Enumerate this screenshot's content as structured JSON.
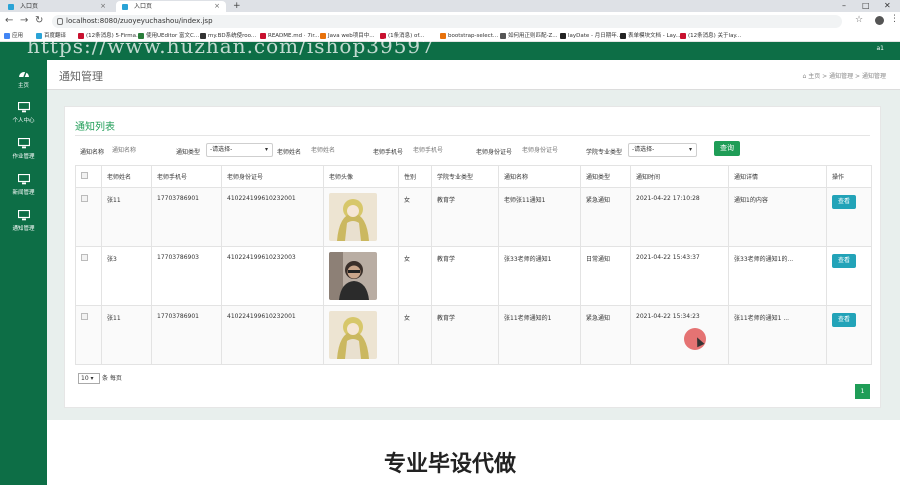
{
  "browser": {
    "tabs": [
      {
        "title": "入口页"
      },
      {
        "title": "入口页"
      }
    ],
    "url": "localhost:8080/zuoyeyuchashou/index.jsp",
    "bookmarks": [
      {
        "label": "应用",
        "color": "#4285f4"
      },
      {
        "label": "百度翻译",
        "color": "#2aa3d6"
      },
      {
        "label": "(12条消息) 5·Firma...",
        "color": "#c8102e"
      },
      {
        "label": "使用UEditor 富文C...",
        "color": "#2a7d3a"
      },
      {
        "label": "my.BD系统使roo...",
        "color": "#333333"
      },
      {
        "label": "README.md · 7ir...",
        "color": "#c8102e"
      },
      {
        "label": "Java web项目中...",
        "color": "#e8710a"
      },
      {
        "label": "(1条消息) of...",
        "color": "#c8102e"
      },
      {
        "label": "bootstrap-select...",
        "color": "#e8710a"
      },
      {
        "label": "如何用正则匹配-Z...",
        "color": "#555555"
      },
      {
        "label": "layDate - 月日期年...",
        "color": "#222222"
      },
      {
        "label": "表单模块文档 - Lay...",
        "color": "#222222"
      },
      {
        "label": "(12条消息) 关于lay...",
        "color": "#c8102e"
      }
    ]
  },
  "header": {
    "user": "a1"
  },
  "sidebar": {
    "items": [
      {
        "label": "主页",
        "icon": "dashboard-icon"
      },
      {
        "label": "个人中心",
        "icon": "monitor-icon"
      },
      {
        "label": "作业管理",
        "icon": "monitor-icon"
      },
      {
        "label": "新闻管理",
        "icon": "monitor-icon"
      },
      {
        "label": "通知管理",
        "icon": "monitor-icon"
      }
    ]
  },
  "page": {
    "title": "通知管理",
    "breadcrumb": [
      "主页",
      "通知管理",
      "通知管理"
    ]
  },
  "panel": {
    "title": "通知列表",
    "filters": {
      "notice_name_label": "通知名称",
      "notice_name_placeholder": "通知名称",
      "notice_type_label": "通知类型",
      "notice_type_value": "-请选择-",
      "teacher_name_label": "老师姓名",
      "teacher_name_placeholder": "老师姓名",
      "teacher_phone_label": "老师手机号",
      "teacher_phone_placeholder": "老师手机号",
      "teacher_id_label": "老师身份证号",
      "teacher_id_placeholder": "老师身份证号",
      "major_label": "学院专业类型",
      "major_value": "-请选择-",
      "search_button": "查询"
    },
    "table": {
      "columns": [
        "",
        "老师姓名",
        "老师手机号",
        "老师身份证号",
        "老师头像",
        "性别",
        "学院专业类型",
        "通知名称",
        "通知类型",
        "通知时间",
        "通知详情",
        "操作"
      ],
      "rows": [
        {
          "name": "张11",
          "phone": "17703786901",
          "id_card": "410224199610232001",
          "avatar": "avatar-girl",
          "gender": "女",
          "major": "教育学",
          "notice_name": "老师张11通知1",
          "notice_type": "紧急通知",
          "time": "2021-04-22 17:10:28",
          "detail": "通知1的内容",
          "action": "查看"
        },
        {
          "name": "张3",
          "phone": "17703786903",
          "id_card": "410224199610232003",
          "avatar": "avatar-man",
          "gender": "女",
          "major": "教育学",
          "notice_name": "张33老师的通知1",
          "notice_type": "日常通知",
          "time": "2021-04-22 15:43:37",
          "detail": "张33老师的通知1的...",
          "action": "查看"
        },
        {
          "name": "张11",
          "phone": "17703786901",
          "id_card": "410224199610232001",
          "avatar": "avatar-girl",
          "gender": "女",
          "major": "教育学",
          "notice_name": "张11老师通知的1",
          "notice_type": "紧急通知",
          "time": "2021-04-22 15:34:23",
          "detail": "张11老师的通知1 ...",
          "action": "查看"
        }
      ]
    },
    "pager": {
      "page_size": "10",
      "page_size_suffix": "条 每页",
      "current_page": "1"
    }
  },
  "watermarks": {
    "url_overlay": "https://www.huzhan.com/ishop39597",
    "bottom_text": "专业毕设代做"
  }
}
